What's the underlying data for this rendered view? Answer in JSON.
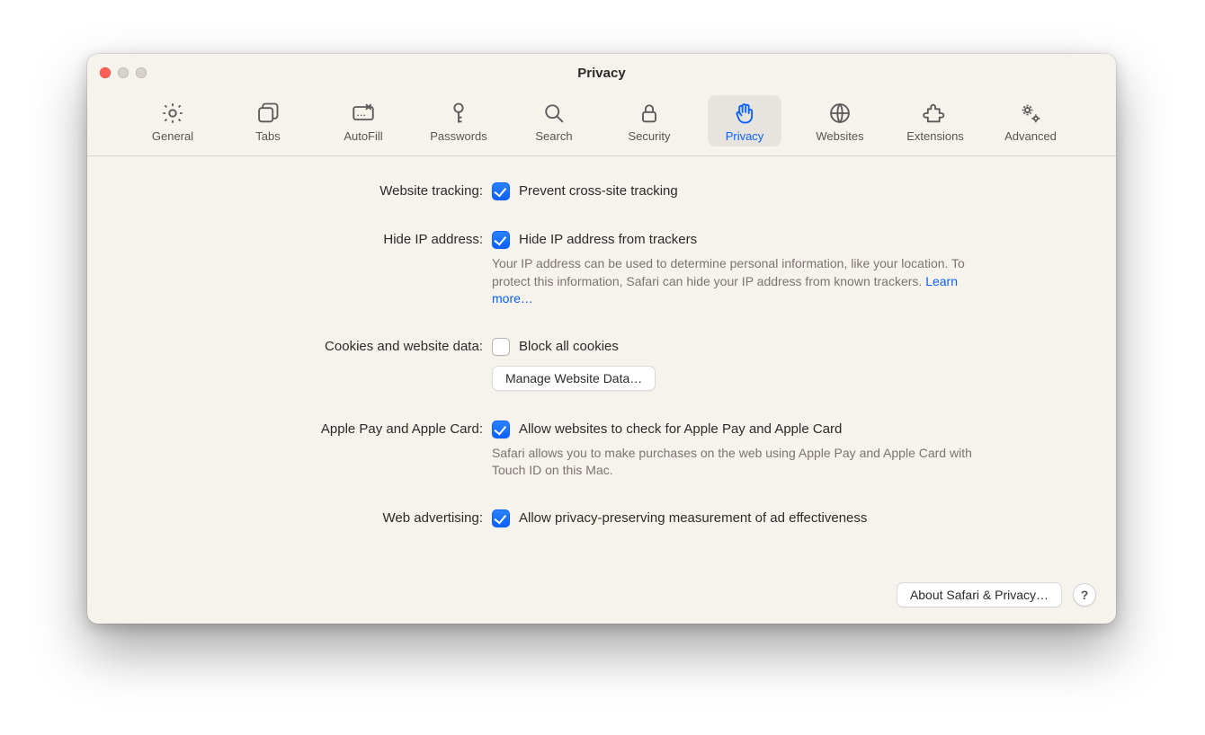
{
  "window": {
    "title": "Privacy"
  },
  "toolbar": {
    "items": [
      {
        "id": "general",
        "label": "General"
      },
      {
        "id": "tabs",
        "label": "Tabs"
      },
      {
        "id": "autofill",
        "label": "AutoFill"
      },
      {
        "id": "passwords",
        "label": "Passwords"
      },
      {
        "id": "search",
        "label": "Search"
      },
      {
        "id": "security",
        "label": "Security"
      },
      {
        "id": "privacy",
        "label": "Privacy"
      },
      {
        "id": "websites",
        "label": "Websites"
      },
      {
        "id": "extensions",
        "label": "Extensions"
      },
      {
        "id": "advanced",
        "label": "Advanced"
      }
    ],
    "active_id": "privacy"
  },
  "form": {
    "website_tracking": {
      "label": "Website tracking:",
      "checkbox_label": "Prevent cross-site tracking",
      "checked": true
    },
    "hide_ip": {
      "label": "Hide IP address:",
      "checkbox_label": "Hide IP address from trackers",
      "checked": true,
      "description": "Your IP address can be used to determine personal information, like your location. To protect this information, Safari can hide your IP address from known trackers. ",
      "learn_more": "Learn more…"
    },
    "cookies": {
      "label": "Cookies and website data:",
      "checkbox_label": "Block all cookies",
      "checked": false,
      "button_label": "Manage Website Data…"
    },
    "apple_pay": {
      "label": "Apple Pay and Apple Card:",
      "checkbox_label": "Allow websites to check for Apple Pay and Apple Card",
      "checked": true,
      "description": "Safari allows you to make purchases on the web using Apple Pay and Apple Card with Touch ID on this Mac."
    },
    "web_advertising": {
      "label": "Web advertising:",
      "checkbox_label": "Allow privacy-preserving measurement of ad effectiveness",
      "checked": true
    }
  },
  "footer": {
    "about_button": "About Safari & Privacy…",
    "help_tooltip": "?"
  }
}
